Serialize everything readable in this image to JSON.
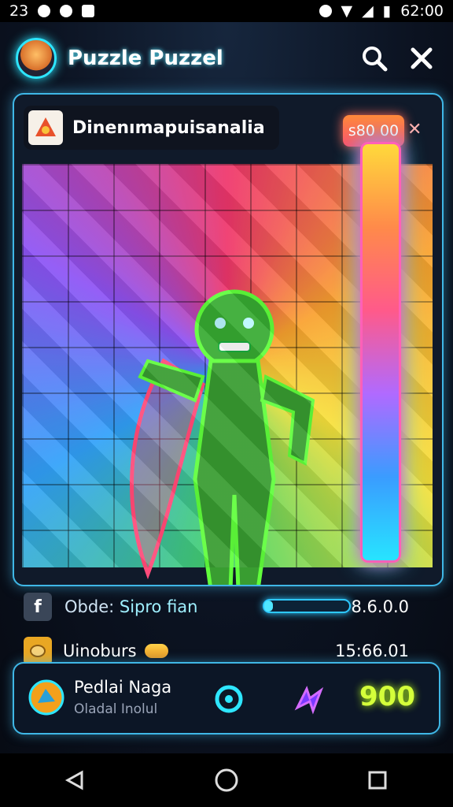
{
  "status_bar": {
    "left_number": "23",
    "time": "62:00"
  },
  "header": {
    "title": "Puzzle Puzzel",
    "icons": [
      "search-icon",
      "close-icon"
    ]
  },
  "level": {
    "name": "Dinenımapuisanalia"
  },
  "meter": {
    "badge": "s80 00"
  },
  "info": {
    "row1": {
      "label": "Obde:",
      "value": "Sipro fian",
      "progress_percent": 10,
      "right": "8.6.0.0"
    },
    "row2": {
      "label": "Uinoburs",
      "right": "15:66.01"
    }
  },
  "footer": {
    "name": "Pedlai Naga",
    "subtitle": "Oladal Inolul",
    "score": "900"
  },
  "colors": {
    "accent": "#2ee6ff",
    "score": "#d4ff3a",
    "meter_border": "#ff60b8"
  }
}
